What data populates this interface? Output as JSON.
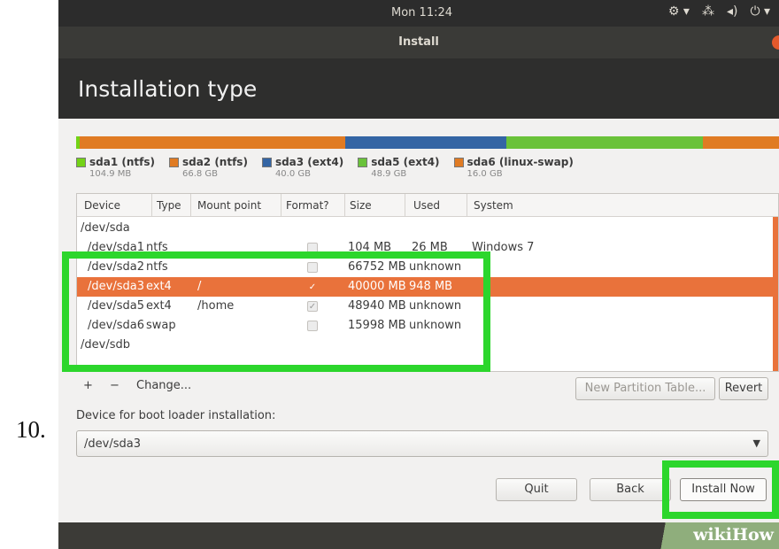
{
  "step_number": "10.",
  "topbar": {
    "clock": "Mon 11:24",
    "icons": [
      "accessibility-icon",
      "network-icon",
      "volume-icon",
      "power-icon"
    ]
  },
  "window": {
    "title": "Install"
  },
  "page": {
    "heading": "Installation type"
  },
  "partition_bar": {
    "segments": [
      {
        "name": "sda1 (ntfs)",
        "size": "104.9 MB",
        "color": "#73d216"
      },
      {
        "name": "sda2 (ntfs)",
        "size": "66.8 GB",
        "color": "#e07b23"
      },
      {
        "name": "sda3 (ext4)",
        "size": "40.0 GB",
        "color": "#3465a4"
      },
      {
        "name": "sda5 (ext4)",
        "size": "48.9 GB",
        "color": "#6ac23a"
      },
      {
        "name": "sda6 (linux-swap)",
        "size": "16.0 GB",
        "color": "#e07b23"
      }
    ]
  },
  "table": {
    "headers": [
      "Device",
      "Type",
      "Mount point",
      "Format?",
      "Size",
      "Used",
      "System"
    ],
    "rows": [
      {
        "device": "/dev/sda",
        "type": "",
        "mount": "",
        "format": null,
        "size": "",
        "used": "",
        "system": "",
        "selected": false
      },
      {
        "device": "/dev/sda1",
        "type": "ntfs",
        "mount": "",
        "format": false,
        "size": "104 MB",
        "used": "26 MB",
        "system": "Windows 7",
        "selected": false
      },
      {
        "device": "/dev/sda2",
        "type": "ntfs",
        "mount": "",
        "format": false,
        "size": "66752 MB",
        "used": "unknown",
        "system": "",
        "selected": false
      },
      {
        "device": "/dev/sda3",
        "type": "ext4",
        "mount": "/",
        "format": true,
        "size": "40000 MB",
        "used": "948 MB",
        "system": "",
        "selected": true
      },
      {
        "device": "/dev/sda5",
        "type": "ext4",
        "mount": "/home",
        "format": true,
        "size": "48940 MB",
        "used": "unknown",
        "system": "",
        "selected": false
      },
      {
        "device": "/dev/sda6",
        "type": "swap",
        "mount": "",
        "format": false,
        "size": "15998 MB",
        "used": "unknown",
        "system": "",
        "selected": false
      },
      {
        "device": "/dev/sdb",
        "type": "",
        "mount": "",
        "format": null,
        "size": "",
        "used": "",
        "system": "",
        "selected": false
      }
    ]
  },
  "toolbar": {
    "add_label": "+",
    "remove_label": "−",
    "change_label": "Change...",
    "new_table_label": "New Partition Table...",
    "revert_label": "Revert"
  },
  "bootloader": {
    "label": "Device for boot loader installation:",
    "value": "/dev/sda3"
  },
  "footer": {
    "quit_label": "Quit",
    "back_label": "Back",
    "install_label": "Install Now"
  },
  "watermark": "wikiHow",
  "colors": {
    "highlight": "#2cd62c",
    "selection": "#e9723b",
    "header_bg": "#2e2e2d"
  }
}
